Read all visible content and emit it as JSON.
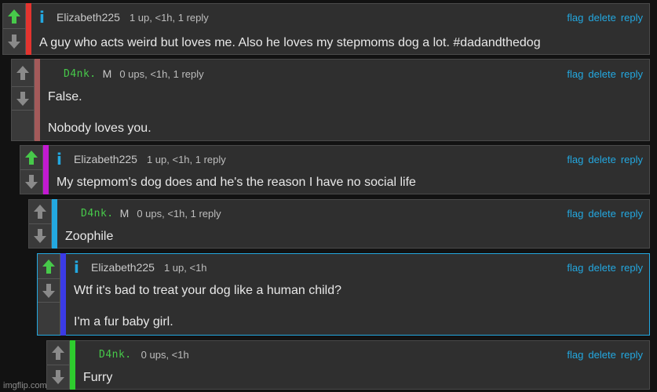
{
  "actions": {
    "flag": "flag",
    "delete": "delete",
    "reply": "reply"
  },
  "watermark": "imgflip.com",
  "colors": {
    "accent_link": "#23a8e0",
    "upvote": "#47c94a",
    "downvote": "#8a8a8a"
  },
  "comments": [
    {
      "user": "Elizabeth225",
      "meta": "1 up, <1h, 1 reply",
      "lines": [
        "A guy who acts weird but loves me. Also he loves my stepmoms dog a lot. #dadandthedog",
        ""
      ],
      "bar": "#e3342f"
    },
    {
      "user": "D4nk.",
      "mark": "M",
      "meta": "0 ups, <1h, 1 reply",
      "lines": [
        "False.",
        "Nobody loves you."
      ],
      "bar": "#a35a5a"
    },
    {
      "user": "Elizabeth225",
      "meta": "1 up, <1h, 1 reply",
      "lines": [
        "My stepmom's dog does and he's the reason I have no social life",
        ""
      ],
      "bar": "#c21ad1"
    },
    {
      "user": "D4nk.",
      "mark": "M",
      "meta": "0 ups, <1h, 1 reply",
      "lines": [
        "Zoophile",
        ""
      ],
      "bar": "#23a8e0"
    },
    {
      "user": "Elizabeth225",
      "meta": "1 up, <1h",
      "lines": [
        "Wtf it's bad to treat your dog like a human child?",
        "I'm a fur baby girl."
      ],
      "bar": "#3b3be6"
    },
    {
      "user": "D4nk.",
      "meta": "0 ups, <1h",
      "lines": [
        "Furry",
        ""
      ],
      "bar": "#2ecc2e"
    }
  ]
}
